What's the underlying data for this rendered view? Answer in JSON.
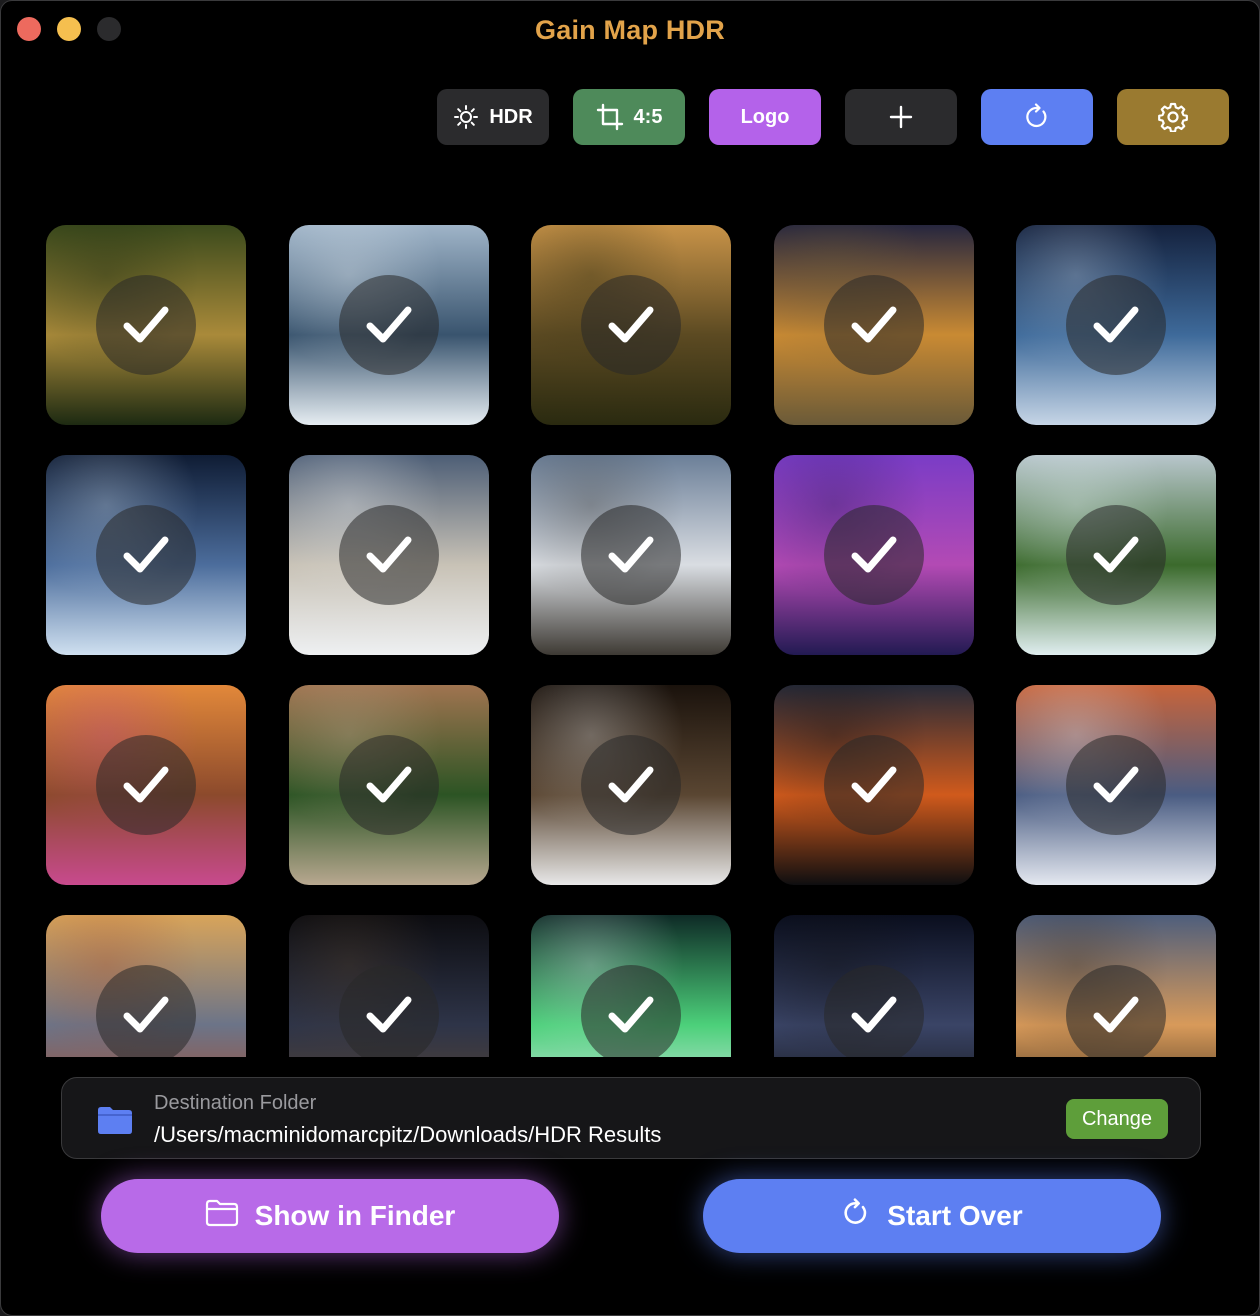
{
  "window": {
    "title": "Gain Map HDR"
  },
  "toolbar": {
    "hdr_label": "HDR",
    "crop_label": "4:5",
    "logo_label": "Logo"
  },
  "grid": {
    "tiles": [
      {
        "scene": "forest path sunbeams",
        "selected": true,
        "colors": [
          "#3b4a1c",
          "#a98a3a",
          "#1d2a12"
        ]
      },
      {
        "scene": "snowy mountain lake",
        "selected": true,
        "colors": [
          "#9fb4c8",
          "#39546e",
          "#e6edf2"
        ]
      },
      {
        "scene": "forest river sunset",
        "selected": true,
        "colors": [
          "#c89348",
          "#5c4a22",
          "#2a2a10"
        ]
      },
      {
        "scene": "desert river starry sunset",
        "selected": true,
        "colors": [
          "#26263e",
          "#c98a33",
          "#6a5a38"
        ]
      },
      {
        "scene": "night sea rocks",
        "selected": true,
        "colors": [
          "#14213d",
          "#3e6a9a",
          "#c6d5e6"
        ]
      },
      {
        "scene": "night waterfall mountains",
        "selected": true,
        "colors": [
          "#0f1c34",
          "#4c6d9c",
          "#cfe0f0"
        ]
      },
      {
        "scene": "snowy mountain valley sun",
        "selected": true,
        "colors": [
          "#4d5e76",
          "#c8c2b6",
          "#eef0f2"
        ]
      },
      {
        "scene": "snowy peaks sun",
        "selected": true,
        "colors": [
          "#6b7f98",
          "#d9dde2",
          "#3e3a34"
        ]
      },
      {
        "scene": "purple lake night",
        "selected": true,
        "colors": [
          "#7a3cc6",
          "#b34ab4",
          "#221a52"
        ]
      },
      {
        "scene": "waterfalls green valley",
        "selected": true,
        "colors": [
          "#b8c6cc",
          "#3b6a2c",
          "#e0eef0"
        ]
      },
      {
        "scene": "sunset flower meadow",
        "selected": true,
        "colors": [
          "#e2883a",
          "#8c4a2c",
          "#c84a8e"
        ]
      },
      {
        "scene": "forest road",
        "selected": true,
        "colors": [
          "#a07450",
          "#2c5424",
          "#b8a890"
        ]
      },
      {
        "scene": "cave light beam",
        "selected": true,
        "colors": [
          "#1a120c",
          "#5a4632",
          "#e8e8e8"
        ]
      },
      {
        "scene": "volcano lightning",
        "selected": true,
        "colors": [
          "#262a38",
          "#d05a1c",
          "#0e0e10"
        ]
      },
      {
        "scene": "snowy river sunset",
        "selected": true,
        "colors": [
          "#c8643a",
          "#4a5c82",
          "#e4e8f0"
        ]
      },
      {
        "scene": "mountain lake flowers",
        "selected": true,
        "colors": [
          "#d8a45a",
          "#6c7488",
          "#a84c2c"
        ]
      },
      {
        "scene": "cave milky way",
        "selected": true,
        "colors": [
          "#0c0c10",
          "#2e3448",
          "#5a4630"
        ]
      },
      {
        "scene": "aurora snowy forest",
        "selected": true,
        "colors": [
          "#0e2a26",
          "#4cd07a",
          "#dfe8ee"
        ]
      },
      {
        "scene": "milky way desert",
        "selected": true,
        "colors": [
          "#0a0e1e",
          "#3a4466",
          "#121212"
        ]
      },
      {
        "scene": "mountain valley sunset",
        "selected": true,
        "colors": [
          "#4e5e7c",
          "#d89a5a",
          "#3a2c1c"
        ]
      }
    ]
  },
  "destination": {
    "label": "Destination Folder",
    "path": "/Users/macminidomarcpitz/Downloads/HDR Results",
    "change_label": "Change"
  },
  "actions": {
    "show_in_finder_label": "Show in Finder",
    "start_over_label": "Start Over"
  },
  "colors": {
    "title": "#e2a34a",
    "crop_button": "#4e8a5a",
    "logo_button": "#b462ea",
    "refresh_button": "#5d7ff2",
    "settings_button": "#9a7a30",
    "change_button": "#5e9e3a"
  },
  "icons": {
    "hdr": "sun-icon",
    "crop": "crop-icon",
    "add": "plus-icon",
    "refresh": "refresh-icon",
    "settings": "gear-icon",
    "folder": "folder-icon",
    "check": "checkmark-icon"
  }
}
